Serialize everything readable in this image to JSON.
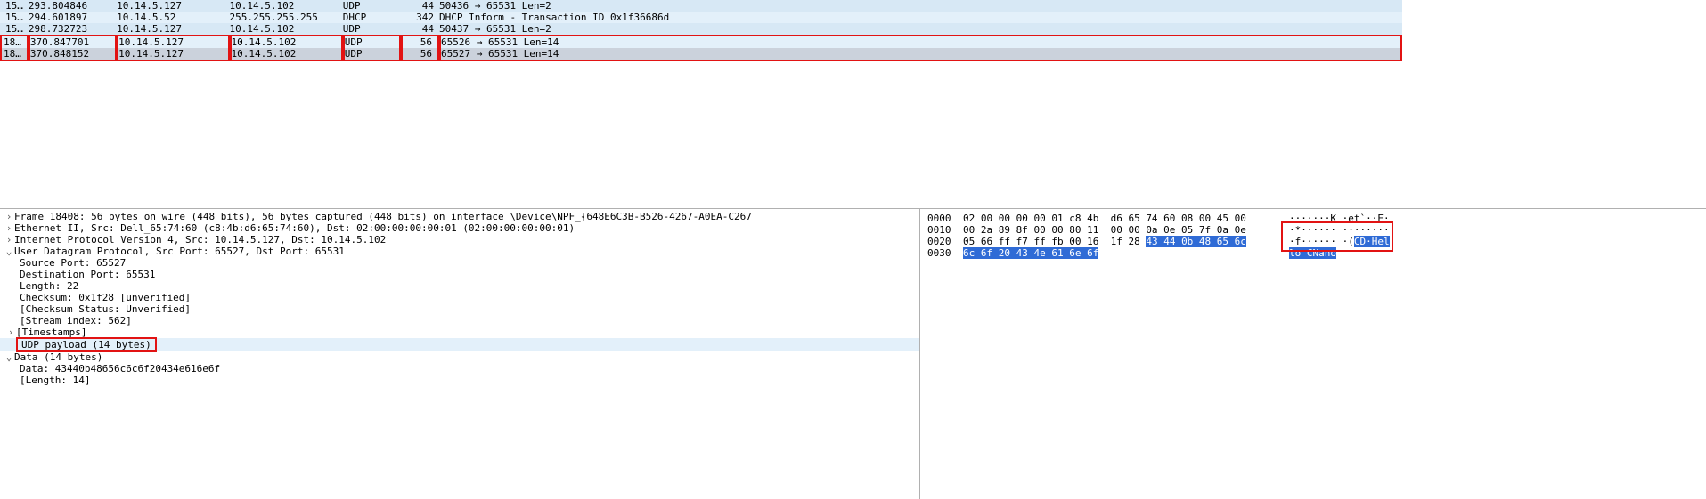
{
  "packet_list": [
    {
      "no": "15…",
      "time": "293.804846",
      "src": "10.14.5.127",
      "dst": "10.14.5.102",
      "proto": "UDP",
      "len": "44",
      "info": "50436 → 65531 Len=2"
    },
    {
      "no": "15…",
      "time": "294.601897",
      "src": "10.14.5.52",
      "dst": "255.255.255.255",
      "proto": "DHCP",
      "len": "342",
      "info": "DHCP Inform   - Transaction ID 0x1f36686d"
    },
    {
      "no": "15…",
      "time": "298.732723",
      "src": "10.14.5.127",
      "dst": "10.14.5.102",
      "proto": "UDP",
      "len": "44",
      "info": "50437 → 65531 Len=2"
    },
    {
      "no": "18…",
      "time": "370.847701",
      "src": "10.14.5.127",
      "dst": "10.14.5.102",
      "proto": "UDP",
      "len": "56",
      "info": "65526 → 65531 Len=14"
    },
    {
      "no": "18…",
      "time": "370.848152",
      "src": "10.14.5.127",
      "dst": "10.14.5.102",
      "proto": "UDP",
      "len": "56",
      "info": "65527 → 65531 Len=14"
    }
  ],
  "detail": {
    "frame": "Frame 18408: 56 bytes on wire (448 bits), 56 bytes captured (448 bits) on interface \\Device\\NPF_{648E6C3B-B526-4267-A0EA-C267",
    "eth": "Ethernet II, Src: Dell_65:74:60 (c8:4b:d6:65:74:60), Dst: 02:00:00:00:00:01 (02:00:00:00:00:01)",
    "ip": "Internet Protocol Version 4, Src: 10.14.5.127, Dst: 10.14.5.102",
    "udp": "User Datagram Protocol, Src Port: 65527, Dst Port: 65531",
    "sp": "Source Port: 65527",
    "dp": "Destination Port: 65531",
    "ln": "Length: 22",
    "ck": "Checksum: 0x1f28 [unverified]",
    "cks": "[Checksum Status: Unverified]",
    "si": "[Stream index: 562]",
    "ts": "[Timestamps]",
    "pl": "UDP payload (14 bytes)",
    "data": "Data (14 bytes)",
    "d1": "Data: 43440b48656c6c6f20434e616e6f",
    "d2": "[Length: 14]"
  },
  "twist": {
    "closed": "›",
    "open": "⌄"
  },
  "hex": {
    "lines": [
      {
        "off": "0000",
        "b1": "02 00 00 00 00 01 c8 4b",
        "b2": "d6 65 74 60 08 00 45 00",
        "a": "·······K ·et`··E·"
      },
      {
        "off": "0010",
        "b1": "00 2a 89 8f 00 00 80 11",
        "b2": "00 00 0a 0e 05 7f 0a 0e",
        "a": "·*······ ········"
      },
      {
        "off": "0020",
        "b1": "05 66 ff f7 ff fb 00 16",
        "b2": "1f 28 ",
        "b2hl": "43 44 0b 48 65 6c",
        "a_pre": "·f······ ·(",
        "a_hl": "CD·Hel"
      },
      {
        "off": "0030",
        "b1hl": "6c 6f 20 43 4e 61 6e 6f",
        "a_hl": "lo CNano"
      }
    ]
  }
}
